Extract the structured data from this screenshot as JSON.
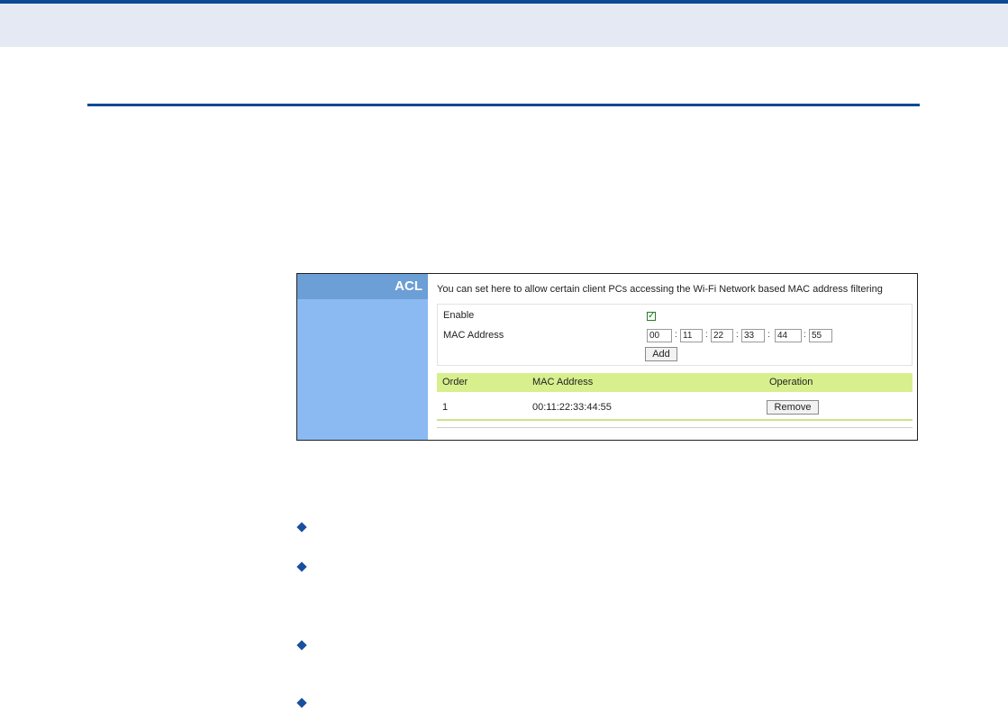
{
  "acl": {
    "title": "ACL",
    "description": "You can set here to allow certain client PCs accessing the Wi-Fi Network based MAC address filtering",
    "enable_label": "Enable",
    "enable_checked": true,
    "mac_label": "MAC Address",
    "mac_octets": [
      "00",
      "11",
      "22",
      "33",
      "44",
      "55"
    ],
    "add_label": "Add",
    "table": {
      "headers": [
        "Order",
        "MAC Address",
        "Operation"
      ],
      "rows": [
        {
          "order": "1",
          "mac": "00:11:22:33:44:55",
          "action": "Remove"
        }
      ]
    }
  },
  "colors": {
    "brand_blue": "#0c4a93",
    "sidebar_blue": "#8bbaf2",
    "sidebar_header": "#6b9fd5",
    "table_header_green": "#d8ef8e"
  },
  "icons": {
    "bullet": "diamond-bullet-icon",
    "checkbox": "check-icon"
  }
}
